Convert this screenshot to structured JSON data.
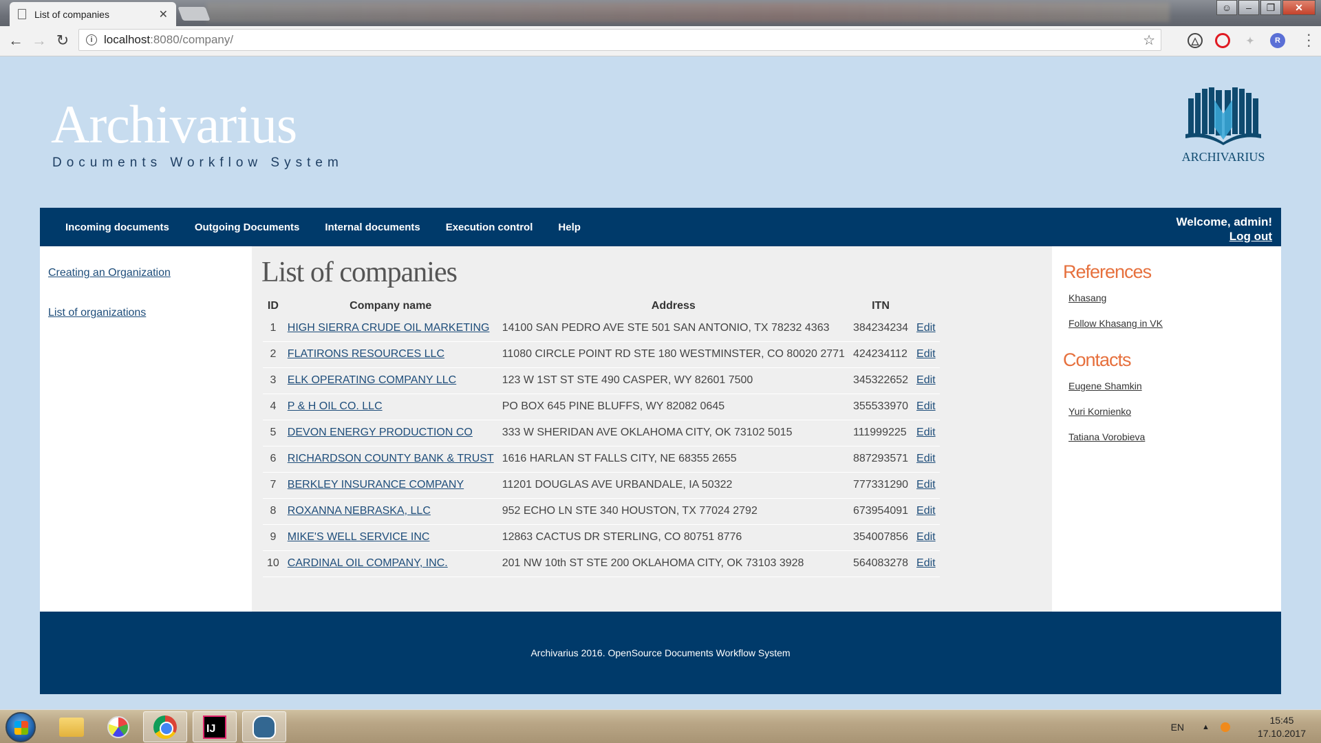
{
  "browser": {
    "tab_title": "List of companies",
    "url_host": "localhost",
    "url_path": ":8080/company/"
  },
  "site": {
    "brand_name": "Archivarius",
    "brand_tagline": "Documents Workflow System",
    "logo_text": "ARCHIVARIUS",
    "logo_color": "#0f4a6f"
  },
  "nav": {
    "items": [
      "Incoming documents",
      "Outgoing Documents",
      "Internal documents",
      "Execution control",
      "Help"
    ],
    "welcome": "Welcome, admin!",
    "logout": "Log out",
    "color": "#003a6a"
  },
  "sidebar": {
    "links": [
      "Creating an Organization",
      "List of organizations"
    ]
  },
  "main": {
    "heading": "List of companies",
    "columns": [
      "ID",
      "Company name",
      "Address",
      "ITN",
      ""
    ],
    "edit_label": "Edit",
    "rows": [
      {
        "id": "1",
        "name": "HIGH SIERRA CRUDE OIL MARKETING",
        "address": "14100 SAN PEDRO AVE STE 501 SAN ANTONIO, TX 78232 4363",
        "itn": "384234234"
      },
      {
        "id": "2",
        "name": "FLATIRONS RESOURCES LLC",
        "address": "11080 CIRCLE POINT RD STE 180 WESTMINSTER, CO 80020 2771",
        "itn": "424234112"
      },
      {
        "id": "3",
        "name": "ELK OPERATING COMPANY LLC",
        "address": "123 W 1ST ST STE 490 CASPER, WY 82601 7500",
        "itn": "345322652"
      },
      {
        "id": "4",
        "name": "P & H OIL CO. LLC",
        "address": "PO BOX 645 PINE BLUFFS, WY 82082 0645",
        "itn": "355533970"
      },
      {
        "id": "5",
        "name": "DEVON ENERGY PRODUCTION CO ",
        "address": "333 W SHERIDAN AVE OKLAHOMA CITY, OK 73102 5015",
        "itn": "111999225"
      },
      {
        "id": "6",
        "name": "RICHARDSON COUNTY BANK & TRUST",
        "address": "1616 HARLAN ST FALLS CITY, NE 68355 2655",
        "itn": "887293571"
      },
      {
        "id": "7",
        "name": "BERKLEY INSURANCE COMPANY",
        "address": "11201 DOUGLAS AVE URBANDALE, IA 50322",
        "itn": "777331290"
      },
      {
        "id": "8",
        "name": "ROXANNA NEBRASKA, LLC",
        "address": "952 ECHO LN STE 340 HOUSTON, TX 77024 2792",
        "itn": "673954091"
      },
      {
        "id": "9",
        "name": "MIKE'S WELL SERVICE INC",
        "address": "12863 CACTUS DR STERLING, CO 80751 8776",
        "itn": "354007856"
      },
      {
        "id": "10",
        "name": "CARDINAL OIL COMPANY, INC.",
        "address": "201 NW 10th ST STE 200 OKLAHOMA CITY, OK 73103 3928",
        "itn": "564083278"
      }
    ]
  },
  "right": {
    "references_title": "References",
    "references": [
      "Khasang",
      "Follow Khasang in VK"
    ],
    "contacts_title": "Contacts",
    "contacts": [
      "Eugene Shamkin",
      "Yuri Kornienko",
      "Tatiana Vorobieva"
    ],
    "accent": "#e6703d"
  },
  "footer": {
    "text": "Archivarius 2016. OpenSource Documents Workflow System"
  },
  "taskbar": {
    "lang": "EN",
    "time": "15:45",
    "date": "17.10.2017",
    "apps": [
      "folder-icon",
      "paint-icon",
      "chrome-icon",
      "intellij-icon",
      "postgres-icon"
    ]
  }
}
